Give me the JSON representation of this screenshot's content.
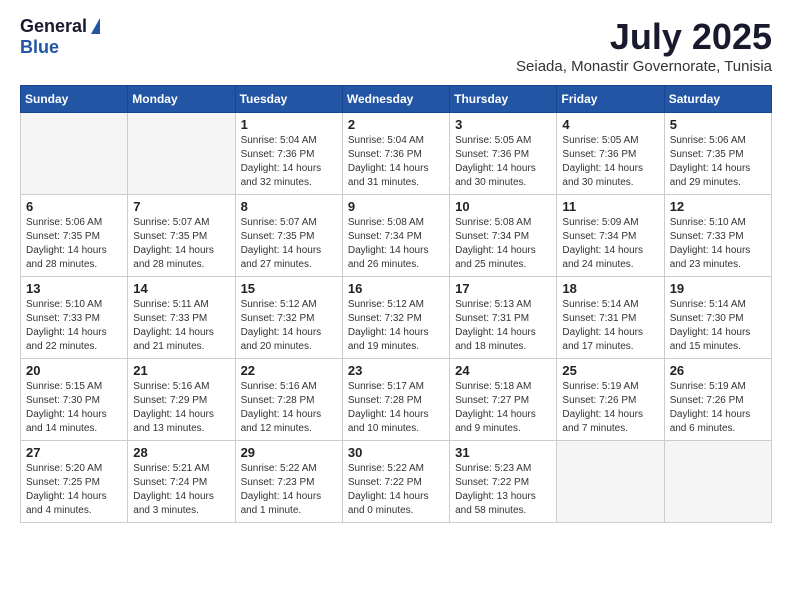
{
  "logo": {
    "general": "General",
    "blue": "Blue"
  },
  "header": {
    "month_year": "July 2025",
    "location": "Seiada, Monastir Governorate, Tunisia"
  },
  "weekdays": [
    "Sunday",
    "Monday",
    "Tuesday",
    "Wednesday",
    "Thursday",
    "Friday",
    "Saturday"
  ],
  "weeks": [
    [
      {
        "day": "",
        "empty": true
      },
      {
        "day": "",
        "empty": true
      },
      {
        "day": "1",
        "sunrise": "Sunrise: 5:04 AM",
        "sunset": "Sunset: 7:36 PM",
        "daylight": "Daylight: 14 hours and 32 minutes."
      },
      {
        "day": "2",
        "sunrise": "Sunrise: 5:04 AM",
        "sunset": "Sunset: 7:36 PM",
        "daylight": "Daylight: 14 hours and 31 minutes."
      },
      {
        "day": "3",
        "sunrise": "Sunrise: 5:05 AM",
        "sunset": "Sunset: 7:36 PM",
        "daylight": "Daylight: 14 hours and 30 minutes."
      },
      {
        "day": "4",
        "sunrise": "Sunrise: 5:05 AM",
        "sunset": "Sunset: 7:36 PM",
        "daylight": "Daylight: 14 hours and 30 minutes."
      },
      {
        "day": "5",
        "sunrise": "Sunrise: 5:06 AM",
        "sunset": "Sunset: 7:35 PM",
        "daylight": "Daylight: 14 hours and 29 minutes."
      }
    ],
    [
      {
        "day": "6",
        "sunrise": "Sunrise: 5:06 AM",
        "sunset": "Sunset: 7:35 PM",
        "daylight": "Daylight: 14 hours and 28 minutes."
      },
      {
        "day": "7",
        "sunrise": "Sunrise: 5:07 AM",
        "sunset": "Sunset: 7:35 PM",
        "daylight": "Daylight: 14 hours and 28 minutes."
      },
      {
        "day": "8",
        "sunrise": "Sunrise: 5:07 AM",
        "sunset": "Sunset: 7:35 PM",
        "daylight": "Daylight: 14 hours and 27 minutes."
      },
      {
        "day": "9",
        "sunrise": "Sunrise: 5:08 AM",
        "sunset": "Sunset: 7:34 PM",
        "daylight": "Daylight: 14 hours and 26 minutes."
      },
      {
        "day": "10",
        "sunrise": "Sunrise: 5:08 AM",
        "sunset": "Sunset: 7:34 PM",
        "daylight": "Daylight: 14 hours and 25 minutes."
      },
      {
        "day": "11",
        "sunrise": "Sunrise: 5:09 AM",
        "sunset": "Sunset: 7:34 PM",
        "daylight": "Daylight: 14 hours and 24 minutes."
      },
      {
        "day": "12",
        "sunrise": "Sunrise: 5:10 AM",
        "sunset": "Sunset: 7:33 PM",
        "daylight": "Daylight: 14 hours and 23 minutes."
      }
    ],
    [
      {
        "day": "13",
        "sunrise": "Sunrise: 5:10 AM",
        "sunset": "Sunset: 7:33 PM",
        "daylight": "Daylight: 14 hours and 22 minutes."
      },
      {
        "day": "14",
        "sunrise": "Sunrise: 5:11 AM",
        "sunset": "Sunset: 7:33 PM",
        "daylight": "Daylight: 14 hours and 21 minutes."
      },
      {
        "day": "15",
        "sunrise": "Sunrise: 5:12 AM",
        "sunset": "Sunset: 7:32 PM",
        "daylight": "Daylight: 14 hours and 20 minutes."
      },
      {
        "day": "16",
        "sunrise": "Sunrise: 5:12 AM",
        "sunset": "Sunset: 7:32 PM",
        "daylight": "Daylight: 14 hours and 19 minutes."
      },
      {
        "day": "17",
        "sunrise": "Sunrise: 5:13 AM",
        "sunset": "Sunset: 7:31 PM",
        "daylight": "Daylight: 14 hours and 18 minutes."
      },
      {
        "day": "18",
        "sunrise": "Sunrise: 5:14 AM",
        "sunset": "Sunset: 7:31 PM",
        "daylight": "Daylight: 14 hours and 17 minutes."
      },
      {
        "day": "19",
        "sunrise": "Sunrise: 5:14 AM",
        "sunset": "Sunset: 7:30 PM",
        "daylight": "Daylight: 14 hours and 15 minutes."
      }
    ],
    [
      {
        "day": "20",
        "sunrise": "Sunrise: 5:15 AM",
        "sunset": "Sunset: 7:30 PM",
        "daylight": "Daylight: 14 hours and 14 minutes."
      },
      {
        "day": "21",
        "sunrise": "Sunrise: 5:16 AM",
        "sunset": "Sunset: 7:29 PM",
        "daylight": "Daylight: 14 hours and 13 minutes."
      },
      {
        "day": "22",
        "sunrise": "Sunrise: 5:16 AM",
        "sunset": "Sunset: 7:28 PM",
        "daylight": "Daylight: 14 hours and 12 minutes."
      },
      {
        "day": "23",
        "sunrise": "Sunrise: 5:17 AM",
        "sunset": "Sunset: 7:28 PM",
        "daylight": "Daylight: 14 hours and 10 minutes."
      },
      {
        "day": "24",
        "sunrise": "Sunrise: 5:18 AM",
        "sunset": "Sunset: 7:27 PM",
        "daylight": "Daylight: 14 hours and 9 minutes."
      },
      {
        "day": "25",
        "sunrise": "Sunrise: 5:19 AM",
        "sunset": "Sunset: 7:26 PM",
        "daylight": "Daylight: 14 hours and 7 minutes."
      },
      {
        "day": "26",
        "sunrise": "Sunrise: 5:19 AM",
        "sunset": "Sunset: 7:26 PM",
        "daylight": "Daylight: 14 hours and 6 minutes."
      }
    ],
    [
      {
        "day": "27",
        "sunrise": "Sunrise: 5:20 AM",
        "sunset": "Sunset: 7:25 PM",
        "daylight": "Daylight: 14 hours and 4 minutes."
      },
      {
        "day": "28",
        "sunrise": "Sunrise: 5:21 AM",
        "sunset": "Sunset: 7:24 PM",
        "daylight": "Daylight: 14 hours and 3 minutes."
      },
      {
        "day": "29",
        "sunrise": "Sunrise: 5:22 AM",
        "sunset": "Sunset: 7:23 PM",
        "daylight": "Daylight: 14 hours and 1 minute."
      },
      {
        "day": "30",
        "sunrise": "Sunrise: 5:22 AM",
        "sunset": "Sunset: 7:22 PM",
        "daylight": "Daylight: 14 hours and 0 minutes."
      },
      {
        "day": "31",
        "sunrise": "Sunrise: 5:23 AM",
        "sunset": "Sunset: 7:22 PM",
        "daylight": "Daylight: 13 hours and 58 minutes."
      },
      {
        "day": "",
        "empty": true
      },
      {
        "day": "",
        "empty": true
      }
    ]
  ]
}
